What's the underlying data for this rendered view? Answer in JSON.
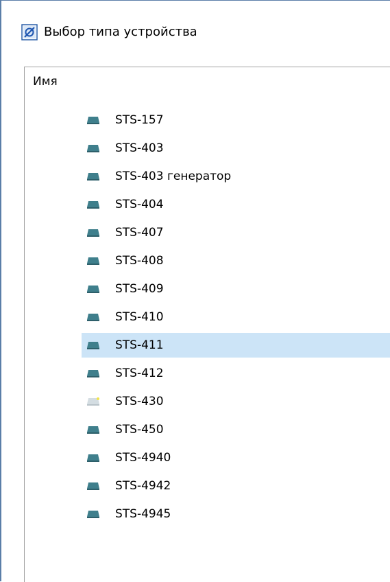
{
  "window": {
    "title": "Выбор типа устройства",
    "icon": "device-type-app-icon"
  },
  "list": {
    "column_header": "Имя",
    "selected_index": 8,
    "items": [
      {
        "label": "STS-157",
        "icon": "device-icon"
      },
      {
        "label": "STS-403",
        "icon": "device-icon"
      },
      {
        "label": "STS-403 генератор",
        "icon": "device-icon"
      },
      {
        "label": "STS-404",
        "icon": "device-icon"
      },
      {
        "label": "STS-407",
        "icon": "device-icon"
      },
      {
        "label": "STS-408",
        "icon": "device-icon"
      },
      {
        "label": "STS-409",
        "icon": "device-icon"
      },
      {
        "label": "STS-410",
        "icon": "device-icon"
      },
      {
        "label": "STS-411",
        "icon": "device-icon"
      },
      {
        "label": "STS-412",
        "icon": "device-icon"
      },
      {
        "label": "STS-430",
        "icon": "device-new-icon"
      },
      {
        "label": "STS-450",
        "icon": "device-icon"
      },
      {
        "label": "STS-4940",
        "icon": "device-icon"
      },
      {
        "label": "STS-4942",
        "icon": "device-icon"
      },
      {
        "label": "STS-4945",
        "icon": "device-icon"
      }
    ]
  },
  "colors": {
    "selection": "#cce4f7",
    "device_icon": "#3f7f8c",
    "device_icon_light": "#d4dde2",
    "new_marker": "#f2e44a",
    "window_border": "#5a7ea8"
  }
}
